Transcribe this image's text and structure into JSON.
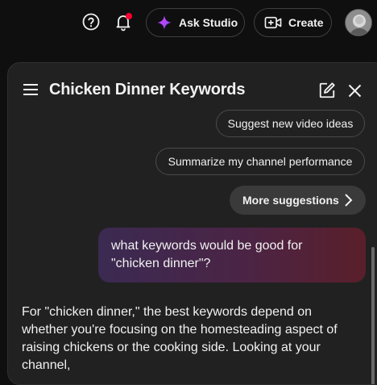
{
  "topbar": {
    "help_icon": "help-circle-icon",
    "notifications_icon": "bell-icon",
    "ask_studio_label": "Ask Studio",
    "create_label": "Create",
    "accent_ask": "#c77dff",
    "notification_dot_color": "#ff0033"
  },
  "panel": {
    "title": "Chicken Dinner Keywords",
    "suggestions": [
      "Suggest new video ideas",
      "Summarize my channel performance"
    ],
    "more_suggestions_label": "More suggestions",
    "user_message": "what keywords would be good for \"chicken dinner\"?",
    "reply_text": "For \"chicken dinner,\" the best keywords depend on whether you're focusing on the homesteading aspect of raising chickens or the cooking side. Looking at your channel,"
  }
}
